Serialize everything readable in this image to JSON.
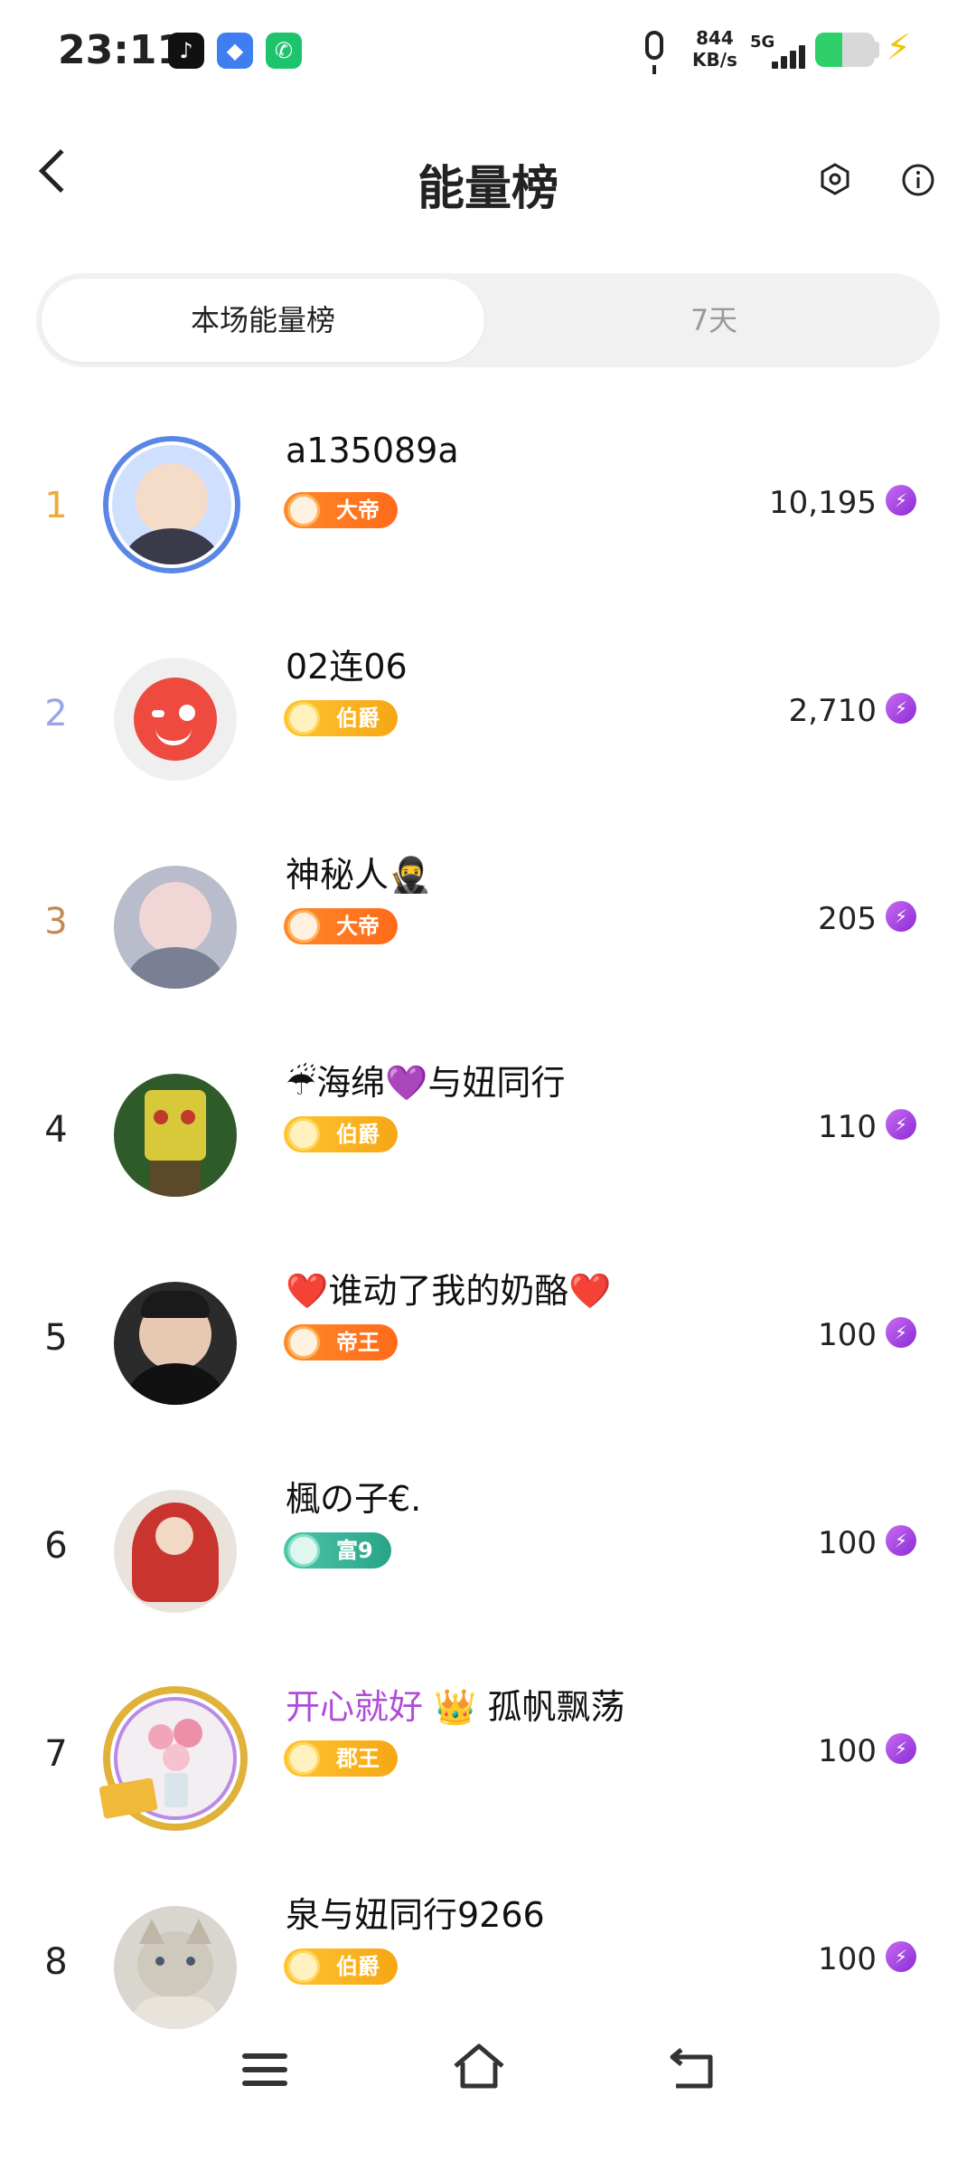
{
  "status_bar": {
    "time": "23:11",
    "net_speed_value": "844",
    "net_speed_unit": "KB/s",
    "network": "5G",
    "battery_level": 0.45,
    "charging": true
  },
  "header": {
    "title": "能量榜",
    "back_icon": "chevron-left-icon",
    "settings_icon": "hexagon-settings-icon",
    "info_icon": "info-icon"
  },
  "tabs": [
    {
      "label": "本场能量榜",
      "active": true
    },
    {
      "label": "7天",
      "active": false
    }
  ],
  "accent_colors": {
    "rank1": "#f2a83a",
    "rank2": "#9aa6e6",
    "rank3": "#c48a52",
    "energy_purple": "#a046e0"
  },
  "rows": [
    {
      "rank": "1",
      "name": "a135089a",
      "name_prefix": "",
      "badge": "大帝",
      "badge_style": "orange",
      "score": "10,195"
    },
    {
      "rank": "2",
      "name": "02连06",
      "name_prefix": "",
      "badge": "伯爵",
      "badge_style": "gold",
      "score": "2,710"
    },
    {
      "rank": "3",
      "name": "神秘人🥷",
      "name_prefix": "",
      "badge": "大帝",
      "badge_style": "orange",
      "score": "205"
    },
    {
      "rank": "4",
      "name": "☔海绵💜与妞同行",
      "name_prefix": "",
      "badge": "伯爵",
      "badge_style": "gold",
      "score": "110"
    },
    {
      "rank": "5",
      "name": "❤️谁动了我的奶酪❤️",
      "name_prefix": "",
      "badge": "帝王",
      "badge_style": "orange",
      "score": "100"
    },
    {
      "rank": "6",
      "name": "楓の子€.",
      "name_prefix": "",
      "badge": "富9",
      "badge_style": "green",
      "score": "100"
    },
    {
      "rank": "7",
      "name": "孤帆飘荡",
      "name_prefix": "开心就好 👑",
      "badge": "郡王",
      "badge_style": "gold",
      "score": "100"
    },
    {
      "rank": "8",
      "name": "泉与妞同行9266",
      "name_prefix": "",
      "badge": "伯爵",
      "badge_style": "gold",
      "score": "100"
    }
  ],
  "nav": {
    "menu_icon": "menu-icon",
    "home_icon": "home-icon",
    "back_icon": "back-icon"
  }
}
